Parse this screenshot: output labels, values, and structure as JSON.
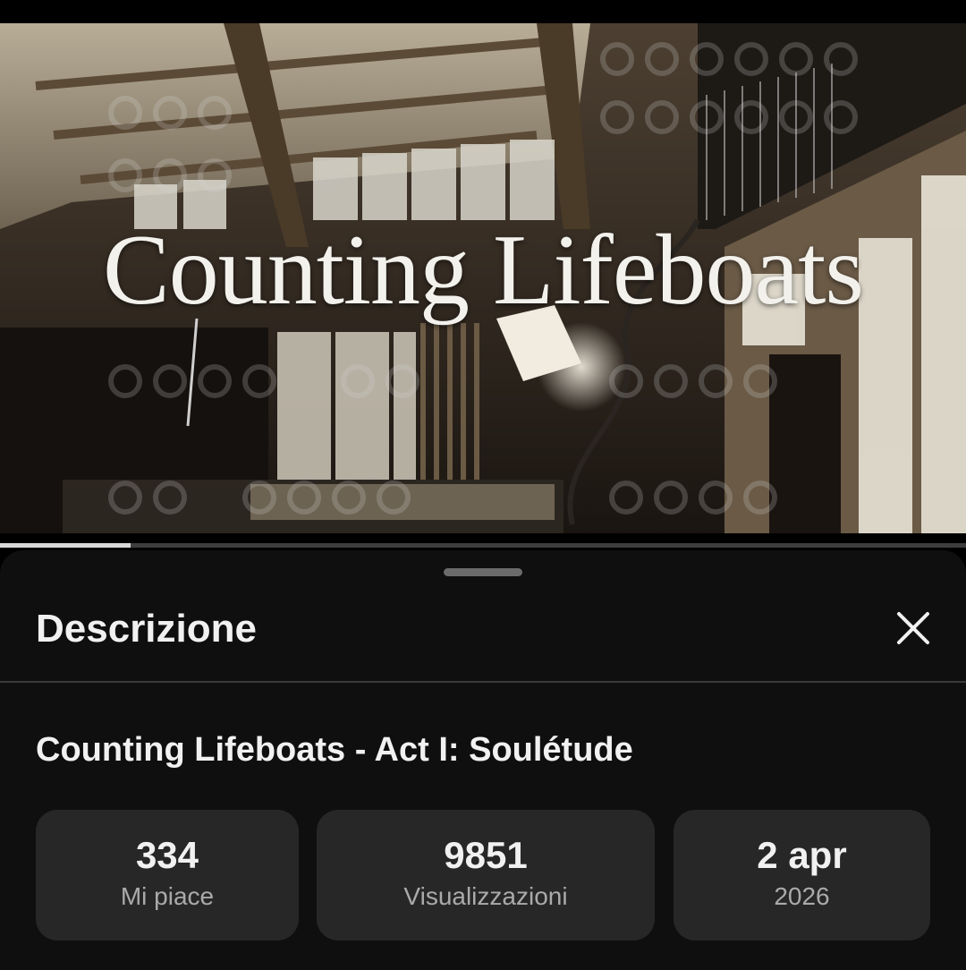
{
  "video": {
    "overlay_title": "Counting Lifeboats",
    "progress_fraction": 0.135
  },
  "description_panel": {
    "header": "Descrizione",
    "close_icon": "close-icon",
    "video_title": "Counting Lifeboats - Act I: Soulétude",
    "stats": {
      "likes": {
        "value": "334",
        "label": "Mi piace"
      },
      "views": {
        "value": "9851",
        "label": "Visualizzazioni"
      },
      "date": {
        "value": "2 apr",
        "label": "2026"
      }
    }
  },
  "colors": {
    "sheet_background": "#0f0f0f",
    "stat_card": "#272727",
    "secondary_text": "#aaaaaa"
  }
}
